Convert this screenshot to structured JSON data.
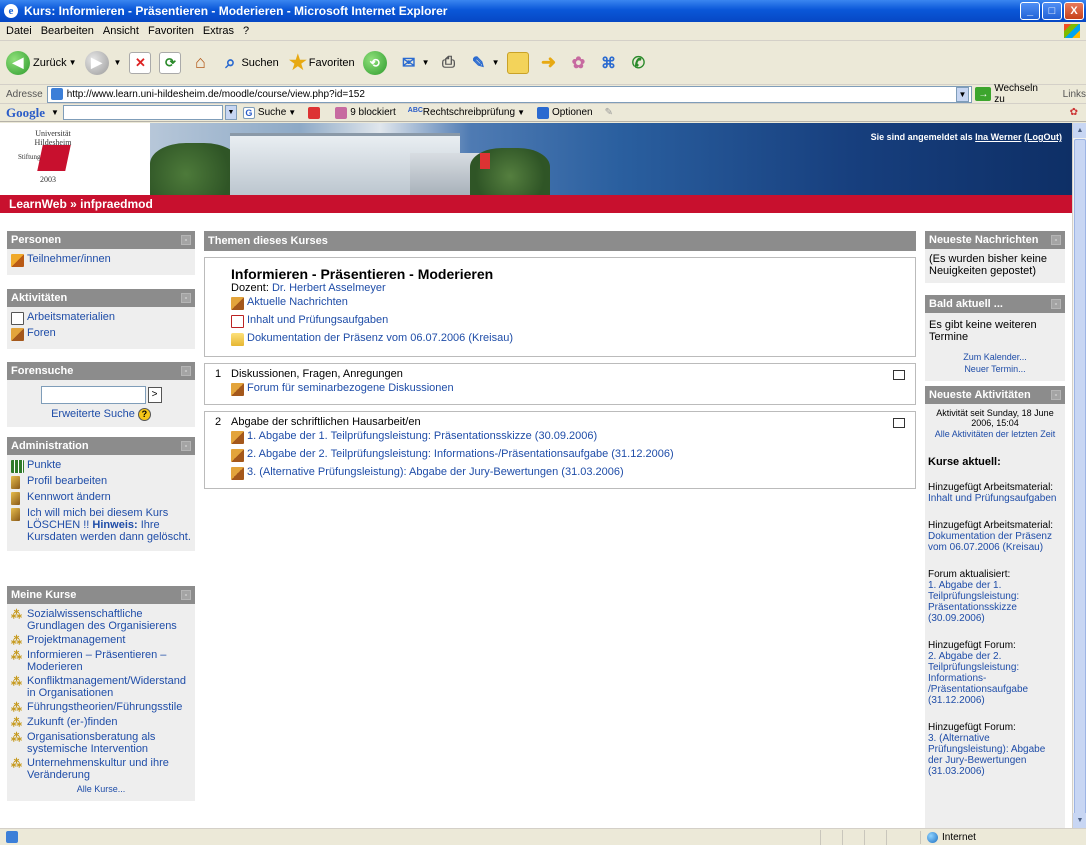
{
  "window": {
    "title": "Kurs: Informieren - Präsentieren - Moderieren - Microsoft Internet Explorer",
    "logo": "e"
  },
  "window_controls": {
    "minimize": "_",
    "maximize": "□",
    "close": "X"
  },
  "menu": [
    "Datei",
    "Bearbeiten",
    "Ansicht",
    "Favoriten",
    "Extras",
    "?"
  ],
  "toolbar": {
    "back_label": "Zurück",
    "search_label": "Suchen",
    "favorites_label": "Favoriten",
    "back_arrow": "◀",
    "forward_arrow": "▶",
    "stop_glyph": "✕",
    "refresh_glyph": "⟳",
    "home_glyph": "⌂",
    "search_glyph": "⌕",
    "favorites_glyph": "★",
    "history_glyph": "⟲",
    "mail_glyph": "✉",
    "print_glyph": "⎙",
    "edit_glyph": "✎",
    "folder_glyph": "📁",
    "arrow_glyph": "➜",
    "msn_glyph": "✿",
    "research_glyph": "⌘",
    "messenger_glyph": "✆"
  },
  "address_bar": {
    "label": "Adresse",
    "url": "http://www.learn.uni-hildesheim.de/moodle/course/view.php?id=152",
    "go_label": "Wechseln zu",
    "links_label": "Links",
    "dropdown_glyph": "▼",
    "go_glyph": "→"
  },
  "google_bar": {
    "logo": "Google",
    "search_label": "Suche",
    "blocked_label": "9 blockiert",
    "spellcheck_label": "Rechtschreibprüfung",
    "options_label": "Optionen",
    "g_glyph": "G",
    "spell_glyph": "ABC",
    "dropdown_glyph": "▼",
    "pencil_glyph": "✎",
    "right_glyph": "✿"
  },
  "header": {
    "logo_text": "Universität Hildesheim",
    "logo_year": "2003",
    "logo_left_text": "Stiftung",
    "login_prefix": "Sie sind angemeldet als",
    "user_name": "Ina Werner",
    "logout_label": "(LogOut)"
  },
  "breadcrumb": "LearnWeb » infpraedmod",
  "left": {
    "personen": {
      "title": "Personen",
      "items": [
        "Teilnehmer/innen"
      ]
    },
    "aktivitaeten": {
      "title": "Aktivitäten",
      "items": [
        "Arbeitsmaterialien",
        "Foren"
      ]
    },
    "forensuche": {
      "title": "Forensuche",
      "search_value": "",
      "go_label": ">",
      "advanced_label": "Erweiterte Suche",
      "help_glyph": "?"
    },
    "administration": {
      "title": "Administration",
      "items": [
        "Punkte",
        "Profil bearbeiten",
        "Kennwort ändern"
      ],
      "unenrol_text": "Ich will mich bei diesem Kurs LÖSCHEN !!",
      "unenrol_hint_label": "Hinweis:",
      "unenrol_hint_text": "Ihre Kursdaten werden dann gelöscht."
    },
    "meine_kurse": {
      "title": "Meine Kurse",
      "items": [
        "Sozialwissenschaftliche Grundlagen des Organisierens",
        "Projektmanagement",
        "Informieren – Präsentieren – Moderieren",
        "Konfliktmanagement/Widerstand in Organisationen",
        "Führungstheorien/Führungsstile",
        "Zukunft (er-)finden",
        "Organisationsberatung als systemische Intervention",
        "Unternehmenskultur und ihre Veränderung"
      ],
      "all_courses_label": "Alle Kurse...",
      "course_glyph": "⁂"
    },
    "hide_glyph": "-"
  },
  "main": {
    "title": "Themen dieses Kurses",
    "course_title": "Informieren - Präsentieren - Moderieren",
    "lecturer_label": "Dozent:",
    "lecturer_name": "Dr. Herbert Asselmeyer",
    "section0_items": [
      "Aktuelle Nachrichten",
      "Inhalt und Prüfungsaufgaben",
      "Dokumentation der Präsenz vom 06.07.2006 (Kreisau)"
    ],
    "sections": [
      {
        "number": "1",
        "title": "Diskussionen, Fragen, Anregungen",
        "items": [
          "Forum für seminarbezogene Diskussionen"
        ]
      },
      {
        "number": "2",
        "title": "Abgabe der schriftlichen Hausarbeit/en",
        "items": [
          "1. Abgabe der 1. Teilprüfungsleistung: Präsentationsskizze (30.09.2006)",
          "2. Abgabe der 2. Teilprüfungsleistung: Informations-/Präsentationsaufgabe (31.12.2006)",
          "3. (Alternative Prüfungsleistung): Abgabe der Jury-Bewertungen (31.03.2006)"
        ]
      }
    ]
  },
  "right": {
    "news": {
      "title": "Neueste Nachrichten",
      "text": "(Es wurden bisher keine Neuigkeiten gepostet)"
    },
    "upcoming": {
      "title": "Bald aktuell ...",
      "text": "Es gibt keine weiteren Termine",
      "calendar_link": "Zum Kalender...",
      "new_event_link": "Neuer Termin..."
    },
    "activities": {
      "title": "Neueste Aktivitäten",
      "since_text": "Aktivität seit Sunday, 18 June 2006, 15:04",
      "all_link": "Alle Aktivitäten der letzten Zeit",
      "courses_heading": "Kurse aktuell:",
      "entries": [
        {
          "label": "Hinzugefügt Arbeitsmaterial:",
          "link": "Inhalt und Prüfungsaufgaben"
        },
        {
          "label": "Hinzugefügt Arbeitsmaterial:",
          "link": "Dokumentation der Präsenz vom 06.07.2006 (Kreisau)"
        },
        {
          "label": "Forum aktualisiert:",
          "link": "1. Abgabe der 1. Teilprüfungsleistung: Präsentationsskizze (30.09.2006)"
        },
        {
          "label": "Hinzugefügt Forum:",
          "link": "2. Abgabe der 2. Teilprüfungsleistung: Informations- /Präsentationsaufgabe (31.12.2006)"
        },
        {
          "label": "Hinzugefügt Forum:",
          "link": "3. (Alternative Prüfungsleistung): Abgabe der Jury-Bewertungen (31.03.2006)"
        }
      ]
    }
  },
  "scrollbar": {
    "up_glyph": "▲",
    "down_glyph": "▼"
  },
  "status_bar": {
    "zone_label": "Internet"
  },
  "colors": {
    "header_red": "#c8102e",
    "block_grey": "#8c8c8c",
    "link_blue": "#1f4da8"
  }
}
